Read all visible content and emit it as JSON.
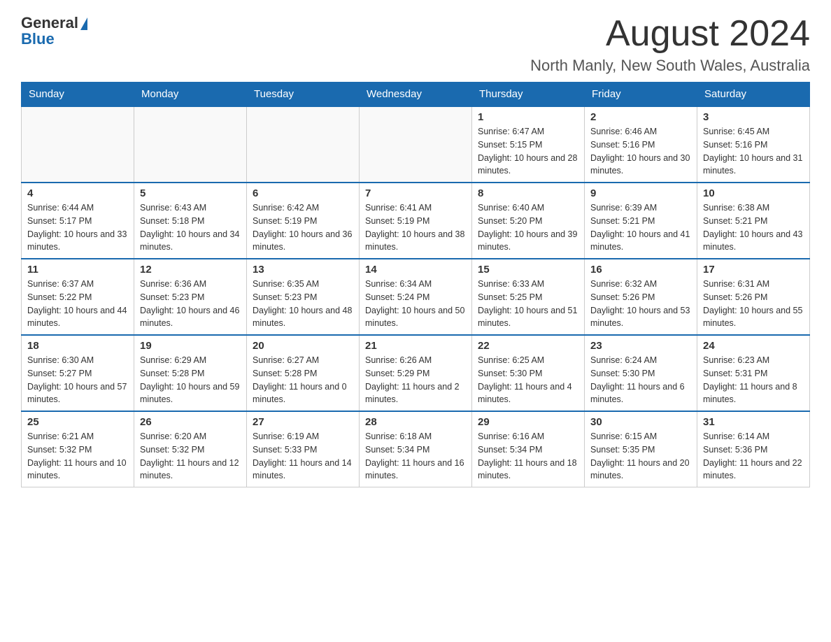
{
  "header": {
    "logo_general": "General",
    "logo_blue": "Blue",
    "month_title": "August 2024",
    "location": "North Manly, New South Wales, Australia"
  },
  "weekdays": [
    "Sunday",
    "Monday",
    "Tuesday",
    "Wednesday",
    "Thursday",
    "Friday",
    "Saturday"
  ],
  "weeks": [
    [
      {
        "day": "",
        "sunrise": "",
        "sunset": "",
        "daylight": ""
      },
      {
        "day": "",
        "sunrise": "",
        "sunset": "",
        "daylight": ""
      },
      {
        "day": "",
        "sunrise": "",
        "sunset": "",
        "daylight": ""
      },
      {
        "day": "",
        "sunrise": "",
        "sunset": "",
        "daylight": ""
      },
      {
        "day": "1",
        "sunrise": "Sunrise: 6:47 AM",
        "sunset": "Sunset: 5:15 PM",
        "daylight": "Daylight: 10 hours and 28 minutes."
      },
      {
        "day": "2",
        "sunrise": "Sunrise: 6:46 AM",
        "sunset": "Sunset: 5:16 PM",
        "daylight": "Daylight: 10 hours and 30 minutes."
      },
      {
        "day": "3",
        "sunrise": "Sunrise: 6:45 AM",
        "sunset": "Sunset: 5:16 PM",
        "daylight": "Daylight: 10 hours and 31 minutes."
      }
    ],
    [
      {
        "day": "4",
        "sunrise": "Sunrise: 6:44 AM",
        "sunset": "Sunset: 5:17 PM",
        "daylight": "Daylight: 10 hours and 33 minutes."
      },
      {
        "day": "5",
        "sunrise": "Sunrise: 6:43 AM",
        "sunset": "Sunset: 5:18 PM",
        "daylight": "Daylight: 10 hours and 34 minutes."
      },
      {
        "day": "6",
        "sunrise": "Sunrise: 6:42 AM",
        "sunset": "Sunset: 5:19 PM",
        "daylight": "Daylight: 10 hours and 36 minutes."
      },
      {
        "day": "7",
        "sunrise": "Sunrise: 6:41 AM",
        "sunset": "Sunset: 5:19 PM",
        "daylight": "Daylight: 10 hours and 38 minutes."
      },
      {
        "day": "8",
        "sunrise": "Sunrise: 6:40 AM",
        "sunset": "Sunset: 5:20 PM",
        "daylight": "Daylight: 10 hours and 39 minutes."
      },
      {
        "day": "9",
        "sunrise": "Sunrise: 6:39 AM",
        "sunset": "Sunset: 5:21 PM",
        "daylight": "Daylight: 10 hours and 41 minutes."
      },
      {
        "day": "10",
        "sunrise": "Sunrise: 6:38 AM",
        "sunset": "Sunset: 5:21 PM",
        "daylight": "Daylight: 10 hours and 43 minutes."
      }
    ],
    [
      {
        "day": "11",
        "sunrise": "Sunrise: 6:37 AM",
        "sunset": "Sunset: 5:22 PM",
        "daylight": "Daylight: 10 hours and 44 minutes."
      },
      {
        "day": "12",
        "sunrise": "Sunrise: 6:36 AM",
        "sunset": "Sunset: 5:23 PM",
        "daylight": "Daylight: 10 hours and 46 minutes."
      },
      {
        "day": "13",
        "sunrise": "Sunrise: 6:35 AM",
        "sunset": "Sunset: 5:23 PM",
        "daylight": "Daylight: 10 hours and 48 minutes."
      },
      {
        "day": "14",
        "sunrise": "Sunrise: 6:34 AM",
        "sunset": "Sunset: 5:24 PM",
        "daylight": "Daylight: 10 hours and 50 minutes."
      },
      {
        "day": "15",
        "sunrise": "Sunrise: 6:33 AM",
        "sunset": "Sunset: 5:25 PM",
        "daylight": "Daylight: 10 hours and 51 minutes."
      },
      {
        "day": "16",
        "sunrise": "Sunrise: 6:32 AM",
        "sunset": "Sunset: 5:26 PM",
        "daylight": "Daylight: 10 hours and 53 minutes."
      },
      {
        "day": "17",
        "sunrise": "Sunrise: 6:31 AM",
        "sunset": "Sunset: 5:26 PM",
        "daylight": "Daylight: 10 hours and 55 minutes."
      }
    ],
    [
      {
        "day": "18",
        "sunrise": "Sunrise: 6:30 AM",
        "sunset": "Sunset: 5:27 PM",
        "daylight": "Daylight: 10 hours and 57 minutes."
      },
      {
        "day": "19",
        "sunrise": "Sunrise: 6:29 AM",
        "sunset": "Sunset: 5:28 PM",
        "daylight": "Daylight: 10 hours and 59 minutes."
      },
      {
        "day": "20",
        "sunrise": "Sunrise: 6:27 AM",
        "sunset": "Sunset: 5:28 PM",
        "daylight": "Daylight: 11 hours and 0 minutes."
      },
      {
        "day": "21",
        "sunrise": "Sunrise: 6:26 AM",
        "sunset": "Sunset: 5:29 PM",
        "daylight": "Daylight: 11 hours and 2 minutes."
      },
      {
        "day": "22",
        "sunrise": "Sunrise: 6:25 AM",
        "sunset": "Sunset: 5:30 PM",
        "daylight": "Daylight: 11 hours and 4 minutes."
      },
      {
        "day": "23",
        "sunrise": "Sunrise: 6:24 AM",
        "sunset": "Sunset: 5:30 PM",
        "daylight": "Daylight: 11 hours and 6 minutes."
      },
      {
        "day": "24",
        "sunrise": "Sunrise: 6:23 AM",
        "sunset": "Sunset: 5:31 PM",
        "daylight": "Daylight: 11 hours and 8 minutes."
      }
    ],
    [
      {
        "day": "25",
        "sunrise": "Sunrise: 6:21 AM",
        "sunset": "Sunset: 5:32 PM",
        "daylight": "Daylight: 11 hours and 10 minutes."
      },
      {
        "day": "26",
        "sunrise": "Sunrise: 6:20 AM",
        "sunset": "Sunset: 5:32 PM",
        "daylight": "Daylight: 11 hours and 12 minutes."
      },
      {
        "day": "27",
        "sunrise": "Sunrise: 6:19 AM",
        "sunset": "Sunset: 5:33 PM",
        "daylight": "Daylight: 11 hours and 14 minutes."
      },
      {
        "day": "28",
        "sunrise": "Sunrise: 6:18 AM",
        "sunset": "Sunset: 5:34 PM",
        "daylight": "Daylight: 11 hours and 16 minutes."
      },
      {
        "day": "29",
        "sunrise": "Sunrise: 6:16 AM",
        "sunset": "Sunset: 5:34 PM",
        "daylight": "Daylight: 11 hours and 18 minutes."
      },
      {
        "day": "30",
        "sunrise": "Sunrise: 6:15 AM",
        "sunset": "Sunset: 5:35 PM",
        "daylight": "Daylight: 11 hours and 20 minutes."
      },
      {
        "day": "31",
        "sunrise": "Sunrise: 6:14 AM",
        "sunset": "Sunset: 5:36 PM",
        "daylight": "Daylight: 11 hours and 22 minutes."
      }
    ]
  ]
}
